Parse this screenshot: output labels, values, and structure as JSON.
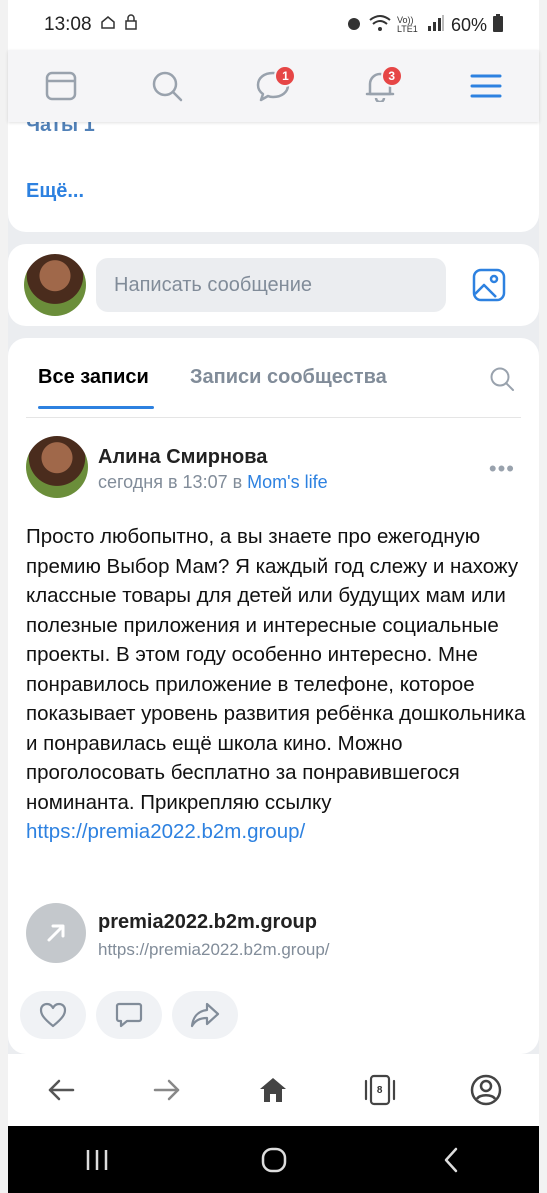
{
  "status_bar": {
    "time": "13:08",
    "battery": "60%",
    "network_label": "Vo)) LTE1"
  },
  "top_nav": {
    "messages_badge": "1",
    "notifications_badge": "3"
  },
  "menu_card": {
    "chats_link": "Чаты 1",
    "more_link": "Ещё..."
  },
  "compose": {
    "placeholder": "Написать сообщение"
  },
  "feed": {
    "tabs": [
      {
        "label": "Все записи",
        "active": true
      },
      {
        "label": "Записи сообщества",
        "active": false
      }
    ],
    "post": {
      "author": "Алина Смирнова",
      "time_prefix": "сегодня в 13:07 в ",
      "group": "Mom's life",
      "text": "Просто любопытно, а вы знаете про ежегодную премию Выбор Мам? Я каждый год слежу и нахожу классные товары для детей или будущих мам или полезные приложения и интересные социальные проекты. В этом году особенно интересно. Мне понравилось приложение в телефоне, которое показывает уровень развития ребёнка дошкольника и понравилась ещё школа кино. Можно проголосовать бесплатно за понравившегося номинанта. Прикрепляю ссылку",
      "url": "https://premia2022.b2m.group/",
      "attachment": {
        "title": "premia2022.b2m.group",
        "subtitle": "https://premia2022.b2m.group/"
      }
    }
  },
  "browser_bar": {
    "tab_count": "8"
  },
  "colors": {
    "accent": "#2d81e0",
    "badge": "#e64646",
    "muted": "#818c99"
  }
}
